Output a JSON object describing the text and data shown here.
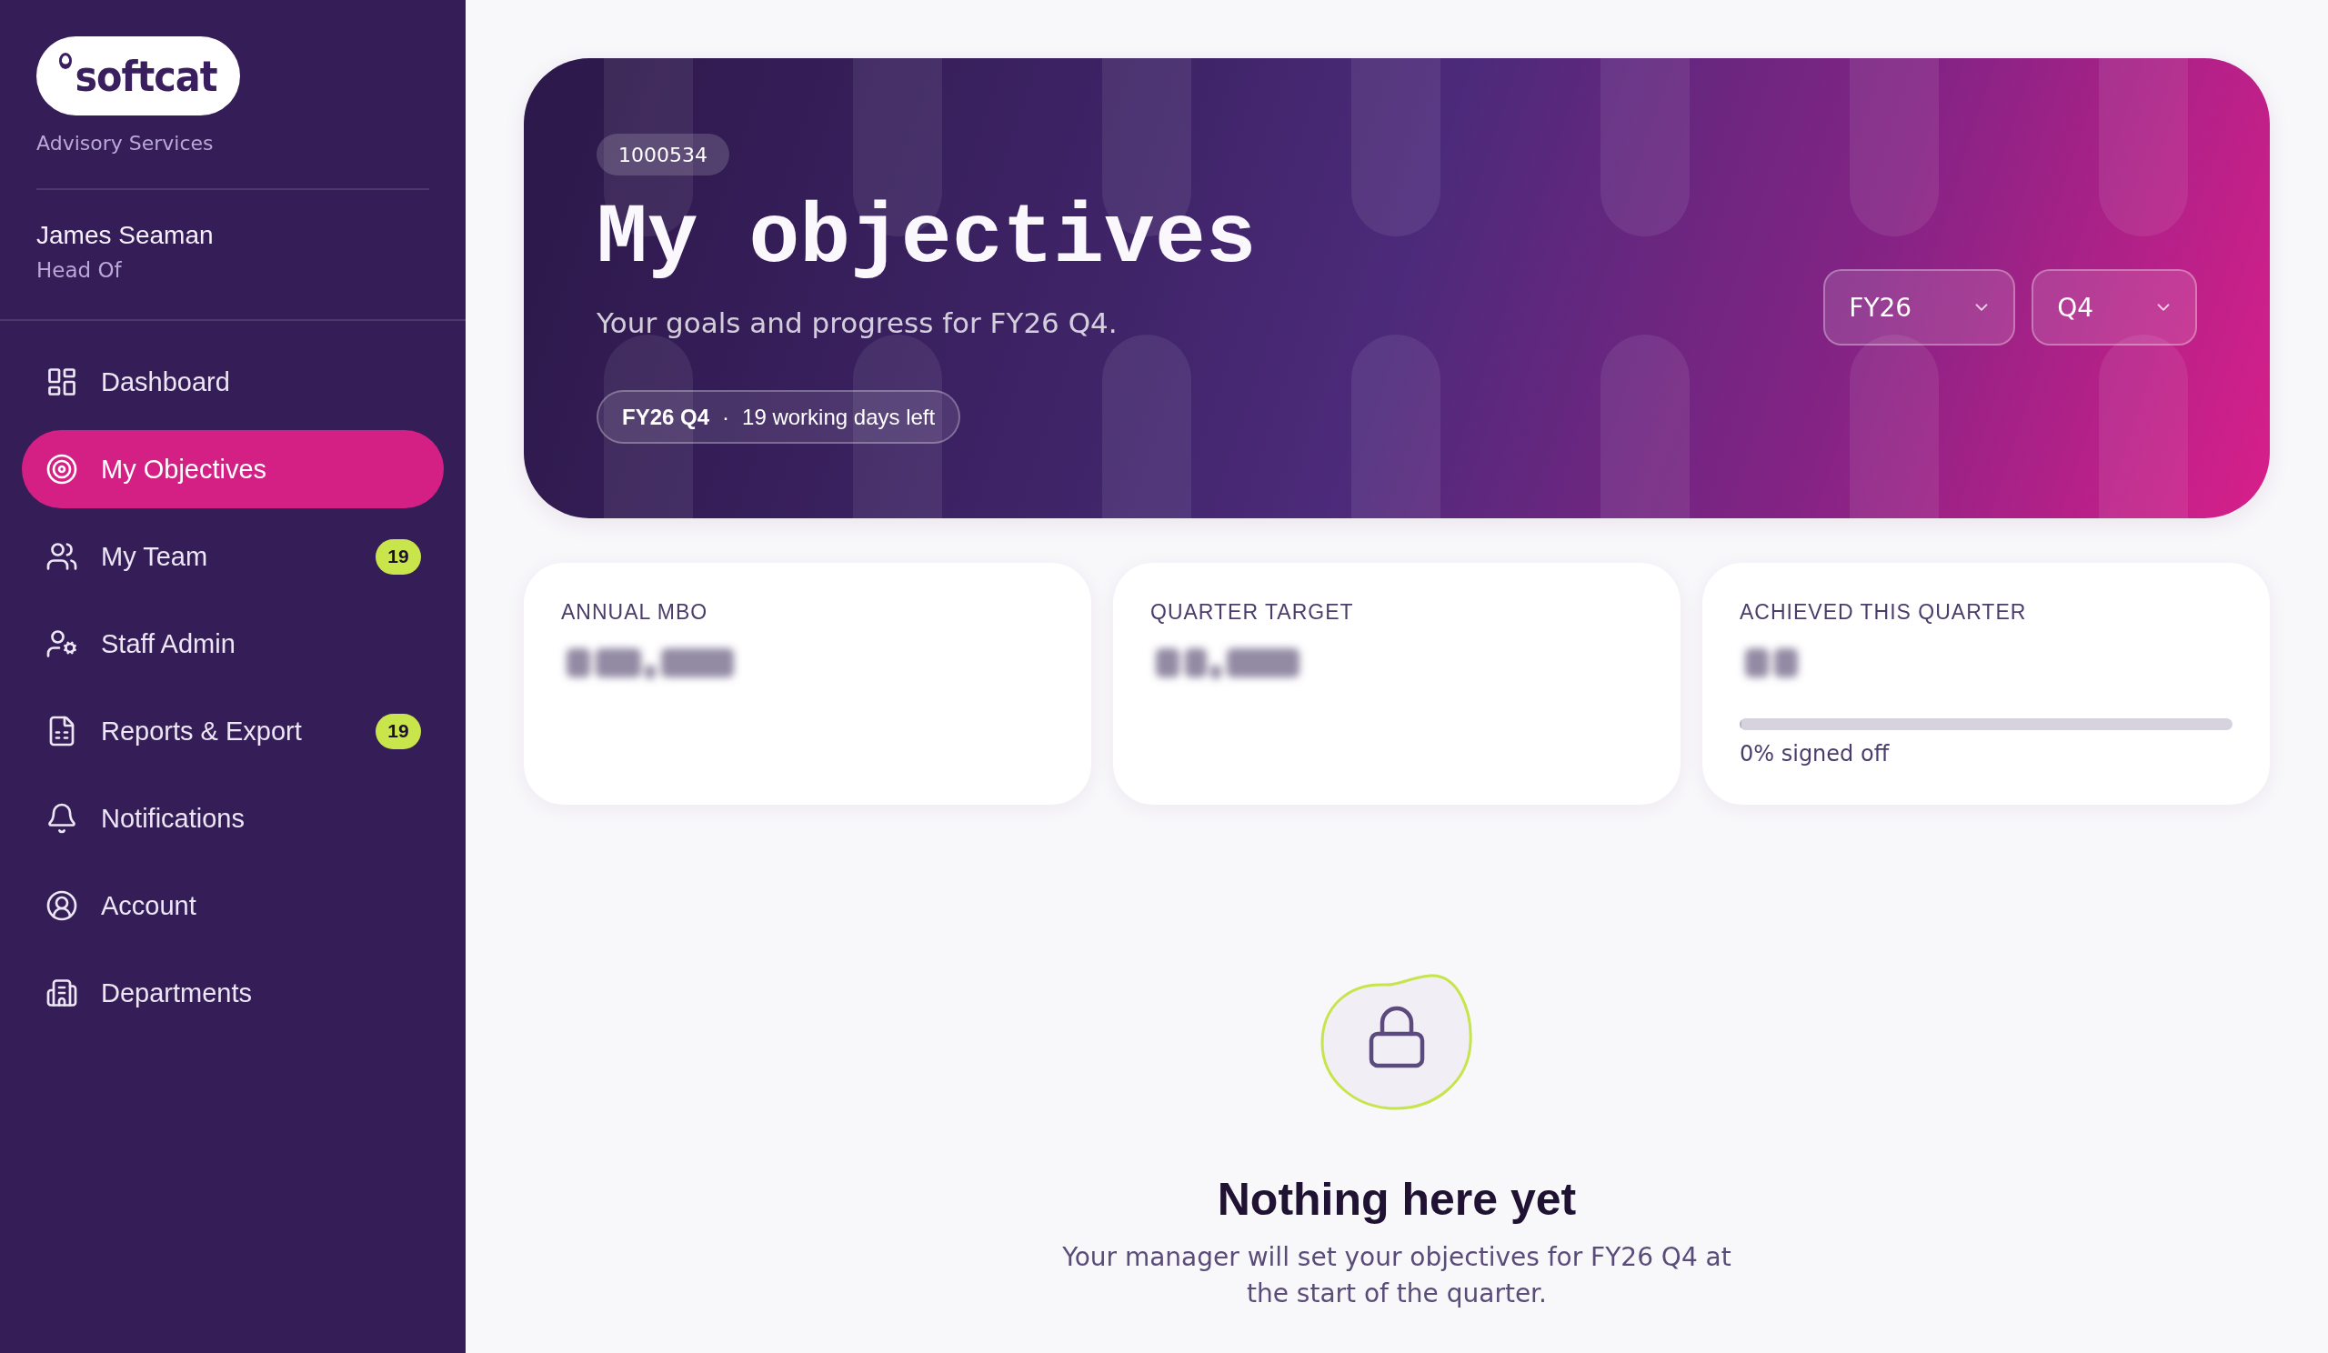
{
  "sidebar": {
    "logo": {
      "wordmark": "softcat"
    },
    "tagline": "Advisory Services",
    "user": {
      "name": "James Seaman",
      "role": "Head Of"
    },
    "nav": [
      {
        "label": "Dashboard",
        "selected": false
      },
      {
        "label": "My Objectives",
        "selected": true
      },
      {
        "label": "My Team",
        "selected": false,
        "badge": "19"
      },
      {
        "label": "Staff Admin",
        "selected": false
      },
      {
        "label": "Reports & Export",
        "selected": false,
        "badge": "19"
      },
      {
        "label": "Notifications",
        "selected": false
      },
      {
        "label": "Account",
        "selected": false
      },
      {
        "label": "Departments",
        "selected": false
      }
    ]
  },
  "header": {
    "id_badge": "1000534",
    "title": "My objectives",
    "subtitle": "Your goals and progress for FY26 Q4.",
    "period": {
      "quarter": "FY26 Q4",
      "separator": "·",
      "days_left": "19 working days left"
    },
    "filters": [
      {
        "value": "FY26"
      },
      {
        "value": "Q4"
      }
    ]
  },
  "summary_cards": [
    {
      "label": "ANNUAL MBO"
    },
    {
      "label": "QUARTER TARGET"
    },
    {
      "label": "ACHIEVED THIS QUARTER",
      "progress": {
        "level": 0,
        "caption": "0% signed off"
      }
    }
  ],
  "empty_state": {
    "title": "Nothing here yet",
    "message": "Your manager will set your objectives for FY26 Q4 at the start of the quarter."
  }
}
